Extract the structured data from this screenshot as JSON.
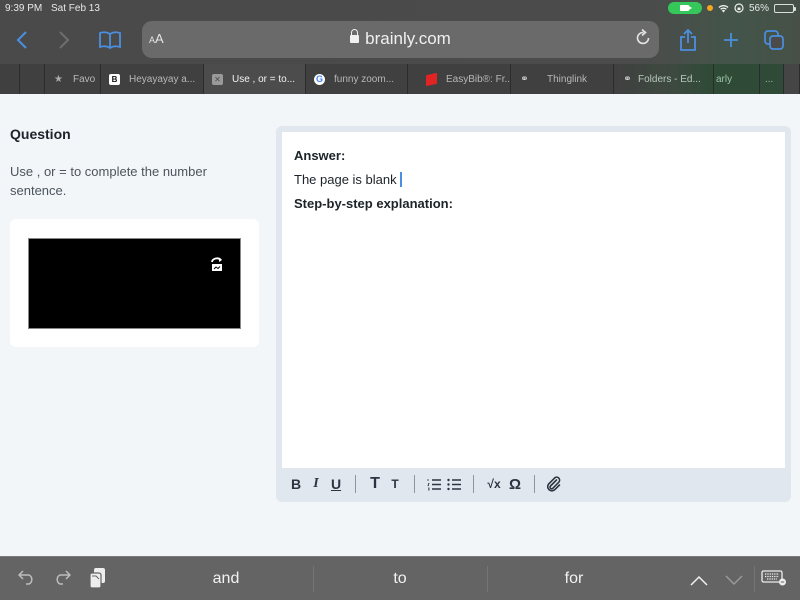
{
  "status_bar": {
    "time": "9:39 PM",
    "date": "Sat Feb 13",
    "battery_percent": "56%",
    "battery_level": 0.56,
    "recording_indicator_color": "#35c759"
  },
  "toolbar": {
    "text_size_label": "AA",
    "url": "brainly.com",
    "accent_color": "#4a8fe0"
  },
  "tabs": [
    {
      "label": "",
      "icon": "blank"
    },
    {
      "label": "",
      "icon": "blank"
    },
    {
      "label": "Favo",
      "icon": "star-icon"
    },
    {
      "label": "Heyayayay a...",
      "icon": "b-logo-icon"
    },
    {
      "label": "Use , or = to...",
      "icon": "close-tab-icon",
      "active": true
    },
    {
      "label": "funny zoom...",
      "icon": "google-icon"
    },
    {
      "label": "EasyBib®: Fr...",
      "icon": "easybib-icon"
    },
    {
      "label": "Thinglink",
      "icon": "thinglink-icon"
    },
    {
      "label": "Folders - Ed...",
      "icon": "thinglink-icon"
    },
    {
      "label": "arly",
      "icon": "blank"
    },
    {
      "label": "...",
      "icon": "blank"
    }
  ],
  "question": {
    "heading": "Question",
    "text": "Use , or = to complete the number sentence."
  },
  "answer": {
    "answer_label": "Answer:",
    "answer_text": "The page is blank",
    "explanation_label": "Step-by-step explanation:"
  },
  "format_toolbar": {
    "bold": "B",
    "italic": "I",
    "underline": "U",
    "text_large": "T",
    "text_small": "T",
    "sqrt": "√x",
    "omega": "Ω"
  },
  "keyboard_bar": {
    "suggestions": [
      "and",
      "to",
      "for"
    ]
  }
}
